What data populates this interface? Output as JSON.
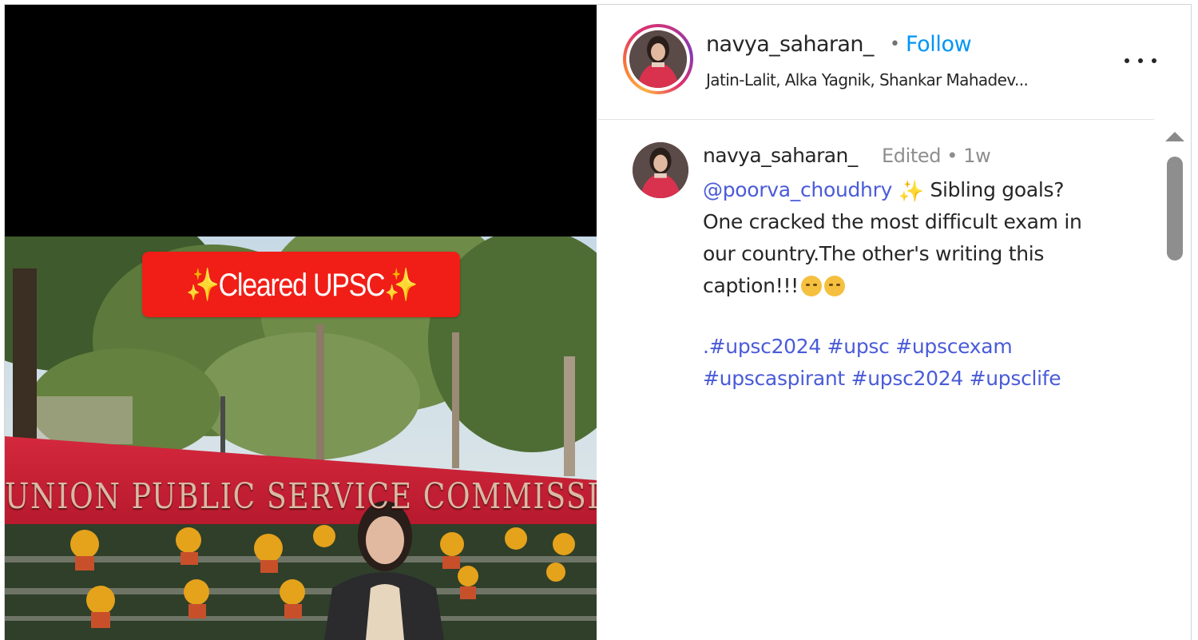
{
  "post": {
    "media": {
      "sticker_left_sparkle": "✨",
      "sticker_text": "Cleared UPSC",
      "sticker_right_sparkle": "✨",
      "sticker_color": "#f01e17",
      "sign_text": "UNION PUBLIC SERVICE COMMISSION"
    },
    "header": {
      "username": "navya_saharan_",
      "separator": "•",
      "follow_label": "Follow",
      "audio": "Jatin-Lalit, Alka Yagnik, Shankar Mahadev...",
      "more_icon": "more-horizontal-icon"
    },
    "caption": {
      "username": "navya_saharan_",
      "meta": "Edited •  1w",
      "mention": "@poorva_choudhry",
      "sparkle": "✨",
      "line1_rest": " Sibling goals?",
      "line2": "One cracked the most difficult exam in",
      "line3": "our country.The other's writing this",
      "line4": "caption!!!",
      "hashtags_line1": ".#upsc2024 #upsc #upscexam",
      "hashtags_line2": "#upscaspirant #upsc2024 #upsclife"
    },
    "colors": {
      "follow": "#0095f6",
      "link": "#4a5bd8",
      "meta": "#8e8e8e"
    }
  }
}
